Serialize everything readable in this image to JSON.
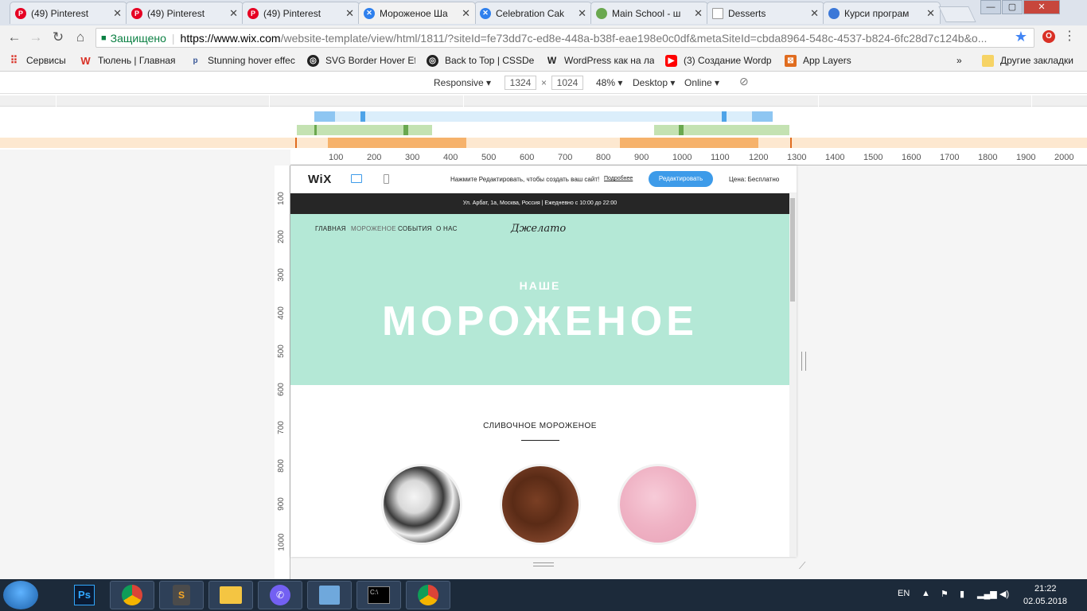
{
  "tabs": [
    {
      "title": "(49) Pinterest",
      "favicon": "pinterest-icon",
      "color": "#e60023"
    },
    {
      "title": "(49) Pinterest",
      "favicon": "pinterest-icon",
      "color": "#e60023"
    },
    {
      "title": "(49) Pinterest",
      "favicon": "pinterest-icon",
      "color": "#e60023"
    },
    {
      "title": "Мороженое Ша",
      "favicon": "wix-icon",
      "color": "#2f80ed",
      "active": true
    },
    {
      "title": "Celebration Cak",
      "favicon": "wix-icon",
      "color": "#2f80ed"
    },
    {
      "title": "Main School - ш",
      "favicon": "globe-icon",
      "color": "#6aa84f"
    },
    {
      "title": "Desserts",
      "favicon": "page-icon",
      "color": "#999999"
    },
    {
      "title": "Курси програм",
      "favicon": "globe-icon",
      "color": "#3c78d8"
    }
  ],
  "window": {
    "minimize": "—",
    "maximize": "▢",
    "close": "✕"
  },
  "toolbar": {
    "secure_label": "Защищено",
    "url_host": "https://www.wix.com",
    "url_path": "/website-template/view/html/1811/?siteId=fe73dd7c-ed8e-448a-b38f-eae198e0c0df&metaSiteId=cbda8964-548c-4537-b824-6fc28d7c124b&o..."
  },
  "bookmarks": [
    {
      "label": "Сервисы",
      "icon": "apps-icon",
      "color": "#d93025"
    },
    {
      "label": "Тюлень | Главная",
      "icon": "w-icon",
      "color": "#d93025"
    },
    {
      "label": "Stunning hover effec",
      "icon": "p-icon",
      "color": "#3b5998"
    },
    {
      "label": "SVG Border Hover Eff",
      "icon": "codepen-icon",
      "color": "#222222"
    },
    {
      "label": "Back to Top | CSSDe",
      "icon": "codepen-icon",
      "color": "#222222"
    },
    {
      "label": "WordPress как на ла",
      "icon": "w-icon",
      "color": "#222222"
    },
    {
      "label": "(3) Создание Wordp",
      "icon": "youtube-icon",
      "color": "#ff0000"
    },
    {
      "label": "App Layers",
      "icon": "layers-icon",
      "color": "#e06c1f"
    }
  ],
  "bookmarks_more": "»",
  "bookmarks_other": "Другие закладки",
  "devtools": {
    "mode": "Responsive",
    "width": "1324",
    "height": "1024",
    "zoom": "48%",
    "device": "Desktop",
    "network": "Online"
  },
  "ruler_x": [
    "100",
    "200",
    "300",
    "400",
    "500",
    "600",
    "700",
    "800",
    "900",
    "1000",
    "1100",
    "1200",
    "1300",
    "1400",
    "1500",
    "1600",
    "1700",
    "1800",
    "1900",
    "2000"
  ],
  "ruler_y": [
    "100",
    "200",
    "300",
    "400",
    "500",
    "600",
    "700",
    "800",
    "900",
    "1000"
  ],
  "wix": {
    "logo": "WiX",
    "prompt": "Нажмите Редактировать, чтобы создать ваш сайт!",
    "more": "Подробнее",
    "edit_button": "Редактировать",
    "price": "Цена: Бесплатно"
  },
  "site": {
    "info": "Ул. Арбат, 1а, Москва, Россия  |  Ежедневно с 10:00 до 22:00",
    "nav": [
      "ГЛАВНАЯ",
      "МОРОЖЕНОЕ",
      "СОБЫТИЯ",
      "О НАС"
    ],
    "brand": "Джелато",
    "hero_small": "НАШЕ",
    "hero_big": "МОРОЖЕНОЕ",
    "section_title": "СЛИВОЧНОЕ МОРОЖЕНОЕ",
    "colors": {
      "hero": "#b4e8d6",
      "info_bar": "#262626",
      "accent": "#3d9be9"
    }
  },
  "taskbar": {
    "apps": [
      "photoshop-icon",
      "chrome-icon",
      "sublime-icon",
      "explorer-icon",
      "viber-icon",
      "control-panel-icon",
      "cmd-icon",
      "chrome-icon"
    ],
    "lang": "EN",
    "time": "21:22",
    "date": "02.05.2018"
  }
}
